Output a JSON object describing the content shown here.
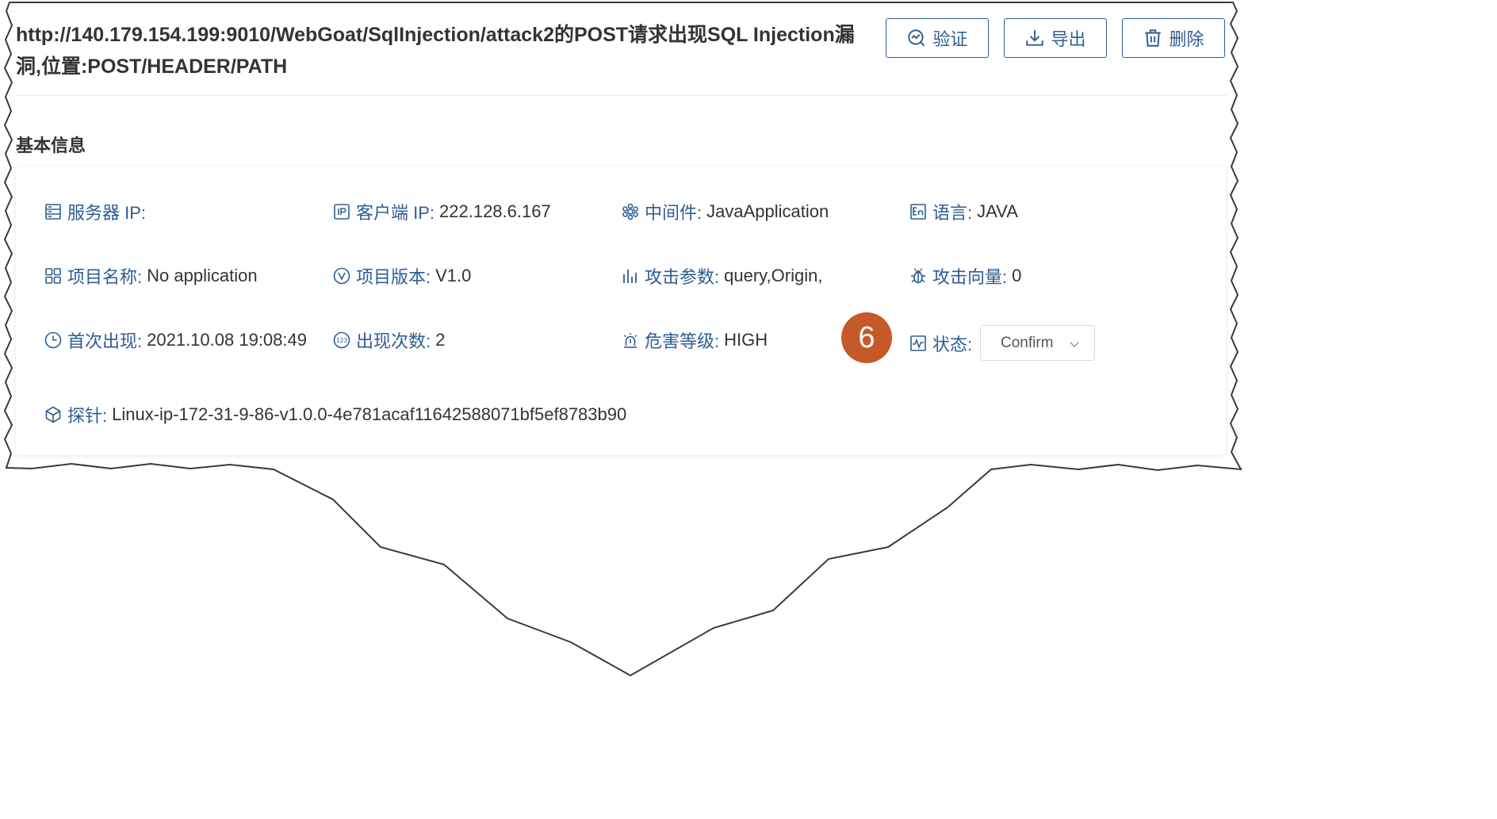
{
  "title": "http://140.179.154.199:9010/WebGoat/SqlInjection/attack2的POST请求出现SQL Injection漏洞,位置:POST/HEADER/PATH",
  "buttons": {
    "verify": "验证",
    "export": "导出",
    "delete": "删除"
  },
  "section_title": "基本信息",
  "fields": {
    "server_ip": {
      "label": "服务器 IP:",
      "value": ""
    },
    "client_ip": {
      "label": "客户端 IP:",
      "value": "222.128.6.167"
    },
    "middleware": {
      "label": "中间件:",
      "value": "JavaApplication"
    },
    "language": {
      "label": "语言:",
      "value": "JAVA"
    },
    "project_name": {
      "label": "项目名称:",
      "value": "No application"
    },
    "project_version": {
      "label": "项目版本:",
      "value": "V1.0"
    },
    "attack_params": {
      "label": "攻击参数:",
      "value": "query,Origin,"
    },
    "attack_vector": {
      "label": "攻击向量:",
      "value": "0"
    },
    "first_seen": {
      "label": "首次出现:",
      "value": "2021.10.08 19:08:49"
    },
    "occurrences": {
      "label": "出现次数:",
      "value": "2"
    },
    "severity": {
      "label": "危害等级:",
      "value": "HIGH"
    },
    "status": {
      "label": "状态:",
      "value": "Confirm"
    },
    "probe": {
      "label": "探针:",
      "value": "Linux-ip-172-31-9-86-v1.0.0-4e781acaf11642588071bf5ef8783b90"
    }
  },
  "callout_number": "6",
  "colors": {
    "accent": "#2f5d93",
    "callout": "#c55a28",
    "text": "#333333"
  }
}
